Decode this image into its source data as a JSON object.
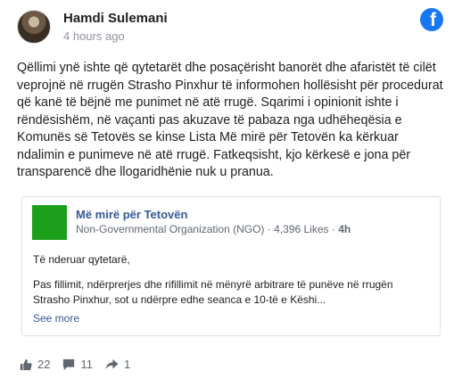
{
  "post": {
    "author": "Hamdi Sulemani",
    "time": "4 hours ago",
    "text": "Qëllimi ynë ishte që qytetarët dhe posaçërisht banorët dhe afaristët të cilët veprojnë në rrugën Strasho Pinxhur të informohen hollësisht për procedurat që kanë të bëjnë me punimet në atë rrugë. Sqarimi i opinionit ishte i rëndësishëm, në vaçanti pas akuzave të pabaza nga udhëheqësia e Komunës së Tetovës se kinse Lista Më mirë për Tetovën ka kërkuar ndalimin e punimeve në atë rrugë. Fatkeqsisht, kjo kërkesë e jona për transparencë dhe llogaridhënie nuk u pranua."
  },
  "shared": {
    "page_name": "Më mirë për Tetovën",
    "category": "Non-Governmental Organization (NGO)",
    "separator": "·",
    "likes": "4,396 Likes",
    "age": "4h",
    "greeting": "Të nderuar qytetarë,",
    "excerpt": "Pas fillimit, ndërprerjes dhe rifillimit në mënyrë arbitrare të punëve në rrugën Strasho Pinxhur, sot u ndërpre edhe seanca e 10-të e Këshi...",
    "see_more": "See more"
  },
  "stats": {
    "likes": "22",
    "comments": "11",
    "shares": "1"
  },
  "colors": {
    "facebook_blue": "#1877f2",
    "link_blue": "#365899",
    "page_logo_green": "#1ca01c",
    "muted": "#90949c"
  },
  "icons": {
    "brand": "facebook-logo-icon",
    "like": "thumbs-up-icon",
    "comment": "comment-icon",
    "share": "share-icon"
  }
}
